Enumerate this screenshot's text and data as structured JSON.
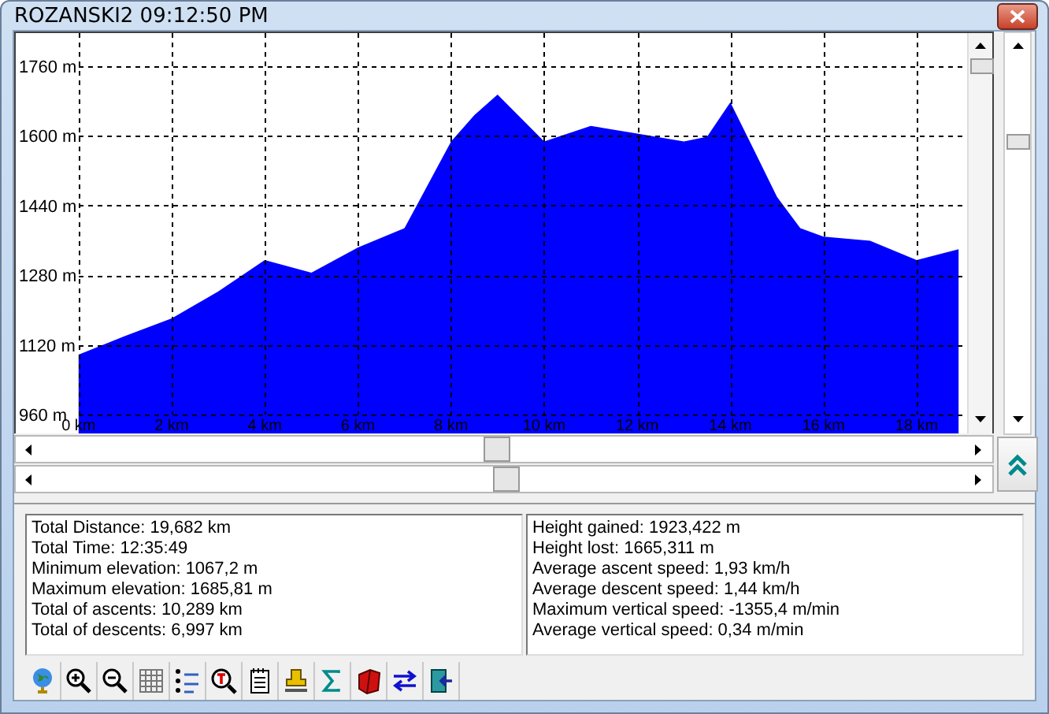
{
  "window": {
    "title": "ROZANSKI2 09:12:50 PM"
  },
  "profile": {
    "chart_data": {
      "type": "area",
      "x": [
        0,
        1,
        2,
        3,
        4,
        5,
        6,
        7,
        8,
        8.5,
        9,
        10,
        11,
        12,
        13,
        13.5,
        14,
        14.5,
        15,
        15.5,
        16,
        17,
        18,
        18.9
      ],
      "grid": true,
      "series": [
        {
          "color": "#0000ff",
          "values": [
            1098,
            1141,
            1181,
            1243,
            1315,
            1286,
            1344,
            1388,
            1587,
            1648,
            1695,
            1587,
            1623,
            1605,
            1587,
            1598,
            1677,
            1569,
            1460,
            1388,
            1369,
            1359,
            1315,
            1340
          ]
        }
      ],
      "xlim": [
        -1.35,
        19.05
      ],
      "ylim": [
        917,
        1836
      ],
      "xticks": [
        {
          "value": 0,
          "label": "0 km"
        },
        {
          "value": 2,
          "label": "2 km"
        },
        {
          "value": 4,
          "label": "4 km"
        },
        {
          "value": 6,
          "label": "6 km"
        },
        {
          "value": 8,
          "label": "8 km"
        },
        {
          "value": 10,
          "label": "10 km"
        },
        {
          "value": 12,
          "label": "12 km"
        },
        {
          "value": 14,
          "label": "14 km"
        },
        {
          "value": 16,
          "label": "16 km"
        },
        {
          "value": 18,
          "label": "18 km"
        }
      ],
      "yticks": [
        {
          "value": 960,
          "label": "960 m"
        },
        {
          "value": 1120,
          "label": "1120 m"
        },
        {
          "value": 1280,
          "label": "1280 m"
        },
        {
          "value": 1440,
          "label": "1440 m"
        },
        {
          "value": 1600,
          "label": "1600 m"
        },
        {
          "value": 1760,
          "label": "1760 m"
        }
      ]
    }
  },
  "stats_left": [
    "Total Distance: 19,682 km",
    "Total Time: 12:35:49",
    "Minimum elevation: 1067,2 m",
    "Maximum elevation: 1685,81 m",
    "Total of ascents: 10,289 km",
    "Total of descents: 6,997 km"
  ],
  "stats_right": [
    "Height gained: 1923,422 m",
    "Height lost: 1665,311 m",
    "Average ascent speed: 1,93 km/h",
    "Average descent speed: 1,44 km/h",
    "Maximum vertical speed: -1355,4 m/min",
    "Average vertical speed: 0,34 m/min"
  ]
}
